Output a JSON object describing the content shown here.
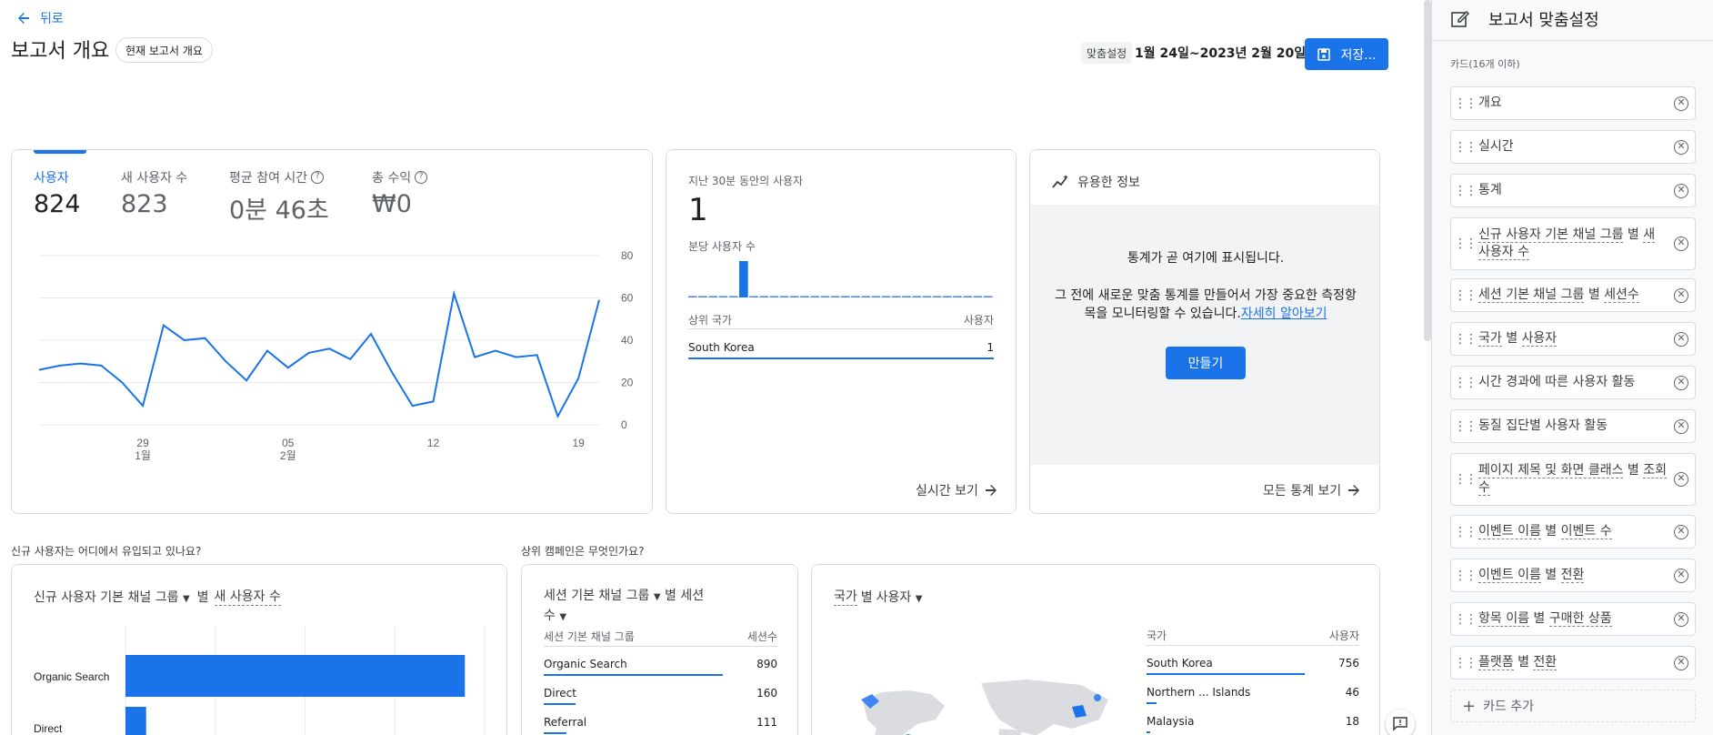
{
  "header": {
    "back_label": "뒤로",
    "title": "보고서 개요",
    "title_chip": "현재 보고서 개요",
    "customize_label": "맞춤설정",
    "date_range": "1월 24일~2023년 2월 20일",
    "save_label": "저장..."
  },
  "metrics": {
    "tabs": [
      {
        "label": "사용자",
        "value": "824"
      },
      {
        "label": "새 사용자 수",
        "value": "823"
      },
      {
        "label": "평균 참여 시간",
        "value": "0분 46초"
      },
      {
        "label": "총 수익",
        "value": "₩0"
      }
    ],
    "y_ticks": [
      "80",
      "60",
      "40",
      "20",
      "0"
    ],
    "x_ticks": [
      {
        "day": "29",
        "month": "1월"
      },
      {
        "day": "05",
        "month": "2월"
      },
      {
        "day": "12",
        "month": ""
      },
      {
        "day": "19",
        "month": ""
      }
    ]
  },
  "realtime": {
    "title": "지난 30분 동안의 사용자",
    "value": "1",
    "per_minute_label": "분당 사용자 수",
    "col_country": "상위 국가",
    "col_users": "사용자",
    "row_country": "South Korea",
    "row_value": "1",
    "view_link": "실시간 보기"
  },
  "insights": {
    "title": "유용한 정보",
    "headline": "통계가 곧 여기에 표시됩니다.",
    "body": "그 전에 새로운 맞춤 통계를 만들어서 가장 중요한 측정항목을 모니터링할 수 있습니다.",
    "learn_more": "자세히 알아보기",
    "create_label": "만들기",
    "view_all": "모든 통계 보기"
  },
  "section1": {
    "title": "신규 사용자는 어디에서 유입되고 있나요?"
  },
  "section2": {
    "title": "상위 캠페인은 무엇인가요?"
  },
  "acq_card": {
    "dimension": "신규 사용자 기본 채널 그룹",
    "by": "별",
    "metric": "새 사용자 수",
    "rows": [
      "Organic Search",
      "Direct"
    ]
  },
  "session_card": {
    "dimension": "세션 기본 채널 그룹",
    "by": "별",
    "metric": "세션수",
    "col_dim": "세션 기본 채널 그룹",
    "col_metric": "세션수",
    "rows": [
      {
        "label": "Organic Search",
        "value": "890"
      },
      {
        "label": "Direct",
        "value": "160"
      },
      {
        "label": "Referral",
        "value": "111"
      }
    ]
  },
  "country_card": {
    "dimension": "국가",
    "by": "별",
    "metric": "사용자",
    "col_dim": "국가",
    "col_metric": "사용자",
    "rows": [
      {
        "label": "South Korea",
        "value": "756"
      },
      {
        "label": "Northern ... Islands",
        "value": "46"
      },
      {
        "label": "Malaysia",
        "value": "18"
      }
    ]
  },
  "panel": {
    "title": "보고서 맞춤설정",
    "cards_label": "카드(16개 이하)",
    "add_label": "카드 추가"
  },
  "chart_data": [
    {
      "type": "line",
      "title": "",
      "xlabel": "",
      "ylabel": "",
      "ylim": [
        0,
        80
      ],
      "x_ticks": [
        "29 1월",
        "05 2월",
        "12",
        "19"
      ],
      "series": [
        {
          "name": "사용자",
          "values": [
            26,
            28,
            29,
            28,
            20,
            9,
            47,
            40,
            41,
            30,
            21,
            35,
            27,
            34,
            36,
            31,
            43,
            25,
            9,
            11,
            62,
            32,
            35,
            32,
            33,
            4,
            22,
            59
          ]
        }
      ]
    },
    {
      "type": "bar",
      "title": "분당 사용자 수",
      "categories": [
        "-29",
        "-28",
        "-27",
        "-26",
        "-25",
        "-24",
        "-23",
        "-22",
        "-21",
        "-20",
        "-19",
        "-18",
        "-17",
        "-16",
        "-15",
        "-14",
        "-13",
        "-12",
        "-11",
        "-10",
        "-9",
        "-8",
        "-7",
        "-6",
        "-5",
        "-4",
        "-3",
        "-2",
        "-1",
        "0"
      ],
      "values": [
        0,
        0,
        0,
        0,
        0,
        1,
        0,
        0,
        0,
        0,
        0,
        0,
        0,
        0,
        0,
        0,
        0,
        0,
        0,
        0,
        0,
        0,
        0,
        0,
        0,
        0,
        0,
        0,
        0,
        0
      ]
    },
    {
      "type": "bar",
      "title": "",
      "categories": [
        "Organic Search",
        "Direct"
      ],
      "values": [
        756,
        46
      ]
    }
  ]
}
